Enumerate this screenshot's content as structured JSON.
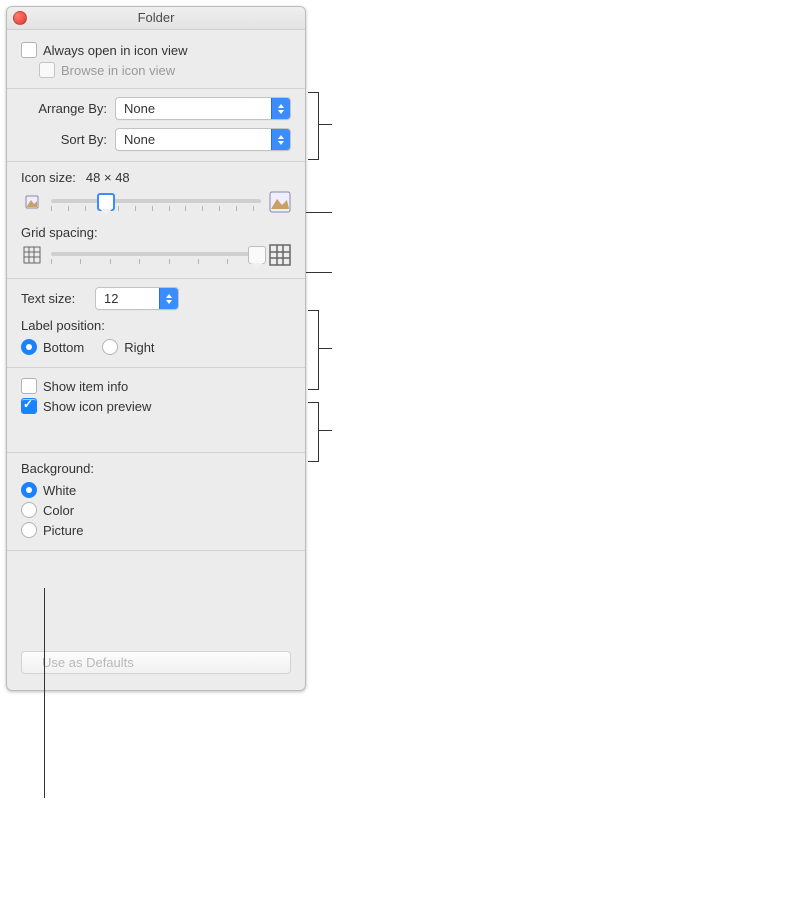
{
  "window": {
    "title": "Folder"
  },
  "top": {
    "always_open_label": "Always open in icon view",
    "always_open_checked": false,
    "browse_label": "Browse in icon view",
    "browse_checked": false
  },
  "arrange": {
    "arrange_label": "Arrange By:",
    "arrange_value": "None",
    "sort_label": "Sort By:",
    "sort_value": "None"
  },
  "icon": {
    "size_label": "Icon size:",
    "size_value": "48 × 48",
    "grid_label": "Grid spacing:"
  },
  "text": {
    "size_label": "Text size:",
    "size_value": "12",
    "labelpos_label": "Label position:",
    "bottom_label": "Bottom",
    "bottom_selected": true,
    "right_label": "Right",
    "right_selected": false
  },
  "show": {
    "iteminfo_label": "Show item info",
    "iteminfo_checked": false,
    "iconpreview_label": "Show icon preview",
    "iconpreview_checked": true
  },
  "bg": {
    "heading": "Background:",
    "white_label": "White",
    "white_selected": true,
    "color_label": "Color",
    "color_selected": false,
    "picture_label": "Picture",
    "picture_selected": false
  },
  "footer": {
    "defaults_button": "Use as Defaults"
  }
}
